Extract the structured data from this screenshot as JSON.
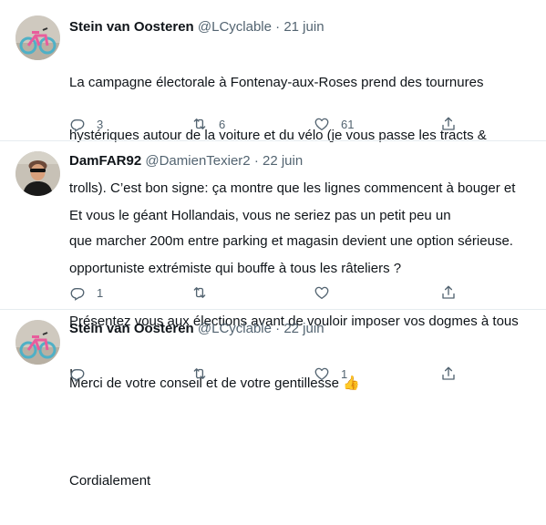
{
  "colors": {
    "text": "#0f1419",
    "secondary": "#536471",
    "divider": "#e6ecf0"
  },
  "tweets": [
    {
      "name": "Stein van Oosteren",
      "handle": "@LCyclable",
      "separator": "·",
      "date": "21 juin",
      "avatar_icon": "avatar-bicycle-icon",
      "lines": [
        "La campagne électorale à Fontenay-aux-Roses prend des tournures",
        "hystériques autour de la voiture et du vélo (je vous passe les tracts &",
        "trolls). C’est bon signe: ça montre que les lignes commencent à bouger et",
        "que marcher 200m entre parking et magasin devient une option sérieuse."
      ],
      "actions": {
        "reply": "3",
        "retweet": "6",
        "like": "61",
        "share": ""
      }
    },
    {
      "name": "DamFAR92",
      "handle": "@DamienTexier2",
      "separator": "·",
      "date": "22 juin",
      "avatar_icon": "avatar-person-sunglasses-icon",
      "lines": [
        "Et vous le géant Hollandais, vous ne seriez pas un petit peu un",
        "opportuniste extrémiste qui bouffe à tous les râteliers ?",
        "Présentez vous aux élections avant de vouloir imposer vos dogmes à tous",
        "!",
        "",
        "Cordialement"
      ],
      "actions": {
        "reply": "1",
        "retweet": "",
        "like": "",
        "share": ""
      }
    },
    {
      "name": "Stein van Oosteren",
      "handle": "@LCyclable",
      "separator": "·",
      "date": "22 juin",
      "avatar_icon": "avatar-bicycle-icon",
      "lines": [
        "Merci de votre conseil et de votre gentillesse 👍"
      ],
      "actions": {
        "reply": "",
        "retweet": "",
        "like": "1",
        "share": ""
      }
    }
  ]
}
